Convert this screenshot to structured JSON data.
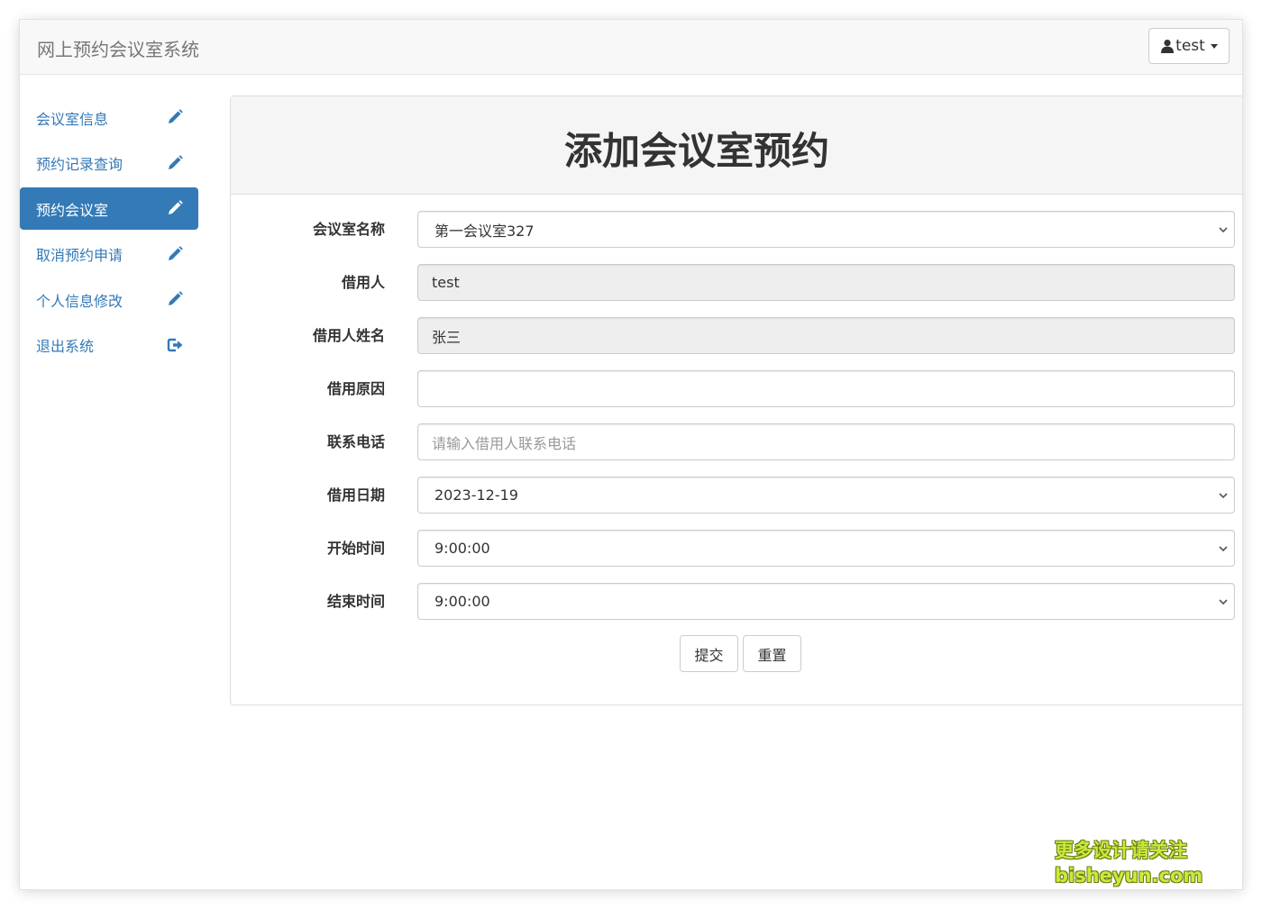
{
  "app": {
    "title": "网上预约会议室系统"
  },
  "header": {
    "user_label": "test",
    "user_icon": "user-icon"
  },
  "sidebar": {
    "items": [
      {
        "label": "会议室信息",
        "icon": "pencil-icon",
        "active": false
      },
      {
        "label": "预约记录查询",
        "icon": "pencil-icon",
        "active": false
      },
      {
        "label": "预约会议室",
        "icon": "pencil-icon",
        "active": true
      },
      {
        "label": "取消预约申请",
        "icon": "pencil-icon",
        "active": false
      },
      {
        "label": "个人信息修改",
        "icon": "pencil-icon",
        "active": false
      },
      {
        "label": "退出系统",
        "icon": "logout-icon",
        "active": false
      }
    ]
  },
  "form": {
    "title": "添加会议室预约",
    "fields": {
      "room": {
        "label": "会议室名称",
        "value": "第一会议室327"
      },
      "borrower": {
        "label": "借用人",
        "value": "test"
      },
      "borrower_name": {
        "label": "借用人姓名",
        "value": "张三"
      },
      "reason": {
        "label": "借用原因",
        "value": ""
      },
      "phone": {
        "label": "联系电话",
        "placeholder": "请输入借用人联系电话"
      },
      "date": {
        "label": "借用日期",
        "value": "2023-12-19"
      },
      "start_time": {
        "label": "开始时间",
        "value": "9:00:00"
      },
      "end_time": {
        "label": "结束时间",
        "value": "9:00:00"
      }
    },
    "submit_label": "提交",
    "reset_label": "重置"
  },
  "watermark": {
    "line1": "更多设计请关注",
    "line2": "bisheyun.com"
  },
  "colors": {
    "accent": "#337ab7",
    "navbar_bg": "#f8f8f8",
    "panel_heading_bg": "#f5f5f5",
    "readonly_bg": "#eeeeee"
  }
}
